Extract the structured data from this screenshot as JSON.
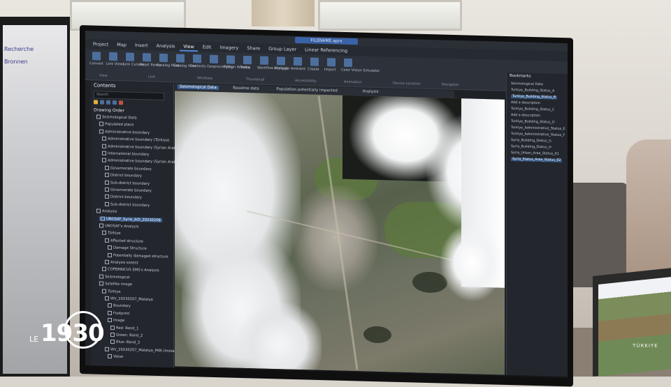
{
  "app": {
    "window_title": "FILENAME.aprx",
    "ribbon_tabs": [
      "Project",
      "Map",
      "Insert",
      "Analysis",
      "View",
      "Edit",
      "Imagery",
      "Share",
      "Group Layer",
      "Linear Referencing"
    ],
    "active_tab": "View",
    "ribbon_buttons": [
      "Convert",
      "Link Views",
      "Link Cursors",
      "Reset Panes",
      "Catalog Pane",
      "Catalog View",
      "Contents",
      "Geoprocessing",
      "Python Window",
      "Tasks",
      "Workflow Manager",
      "Analysis",
      "Ambient",
      "Create",
      "Import",
      "Color Vision Simulator"
    ],
    "ribbon_groups": [
      "View",
      "Link",
      "Windows",
      "Thumbnail",
      "Accessibility",
      "Animation",
      "Device Location",
      "Navigator"
    ]
  },
  "contents": {
    "title": "Contents",
    "search_placeholder": "Search",
    "section": "Drawing Order",
    "items": [
      {
        "label": "Seismological Data",
        "hl": false
      },
      {
        "label": "Populated place",
        "hl": false
      },
      {
        "label": "Administrative boundary",
        "hl": false
      },
      {
        "label": "Administrative boundary (Türkiye)",
        "hl": false
      },
      {
        "label": "Administrative boundary (Syrian Arab Rep)",
        "hl": false
      },
      {
        "label": "International boundary",
        "hl": false
      },
      {
        "label": "Administrative boundary (Syrian Arab R)",
        "hl": false
      },
      {
        "label": "Governorate boundary",
        "hl": false
      },
      {
        "label": "District boundary",
        "hl": false
      },
      {
        "label": "Sub-district boundary",
        "hl": false
      },
      {
        "label": "Governorate boundary",
        "hl": false
      },
      {
        "label": "District boundary",
        "hl": false
      },
      {
        "label": "Sub-district boundary",
        "hl": false
      },
      {
        "label": "Analysis",
        "hl": false
      },
      {
        "label": "UNOSAT_Syria_AOI_20230208",
        "hl": true
      },
      {
        "label": "UNOSAT's Analysis",
        "hl": false
      },
      {
        "label": "Türkiye",
        "hl": false
      },
      {
        "label": "Affected structure",
        "hl": false
      },
      {
        "label": "Damage Structure",
        "hl": false
      },
      {
        "label": "Potentially damaged structure",
        "hl": false
      },
      {
        "label": "Analysis extent",
        "hl": false
      },
      {
        "label": "COPERNICUS EMS's Analysis",
        "hl": false
      },
      {
        "label": "Seismological",
        "hl": false
      },
      {
        "label": "Satellite image",
        "hl": false
      },
      {
        "label": "Türkiye",
        "hl": false
      },
      {
        "label": "WV_20230207_Malatya",
        "hl": false
      },
      {
        "label": "Boundary",
        "hl": false
      },
      {
        "label": "Footprint",
        "hl": false
      },
      {
        "label": "Image",
        "hl": false
      },
      {
        "label": "Red: Band_1",
        "hl": false
      },
      {
        "label": "Green: Band_2",
        "hl": false
      },
      {
        "label": "Blue: Band_3",
        "hl": false
      },
      {
        "label": "WV_20230207_Malatya_PAN (mosaic)",
        "hl": false
      },
      {
        "label": "Value",
        "hl": false
      }
    ]
  },
  "map_tabs": [
    {
      "label": "Seismological Data",
      "active": true
    },
    {
      "label": "Baseline data",
      "active": false
    },
    {
      "label": "Population potentially impacted",
      "active": false
    },
    {
      "label": "Analysis",
      "active": false
    }
  ],
  "bookmarks": {
    "title": "Bookmarks",
    "items": [
      {
        "label": "Seismological Data",
        "sel": false
      },
      {
        "label": "Turkiye_Building_Status_A",
        "sel": false
      },
      {
        "label": "Turkiye_Building_Status_B",
        "sel": true
      },
      {
        "label": "Add a description",
        "sel": false
      },
      {
        "label": "Turkiye_Building_Status_C",
        "sel": false
      },
      {
        "label": "Add a description",
        "sel": false
      },
      {
        "label": "Turkiye_Building_Status_D",
        "sel": false
      },
      {
        "label": "Turkiye_Administrative_Status_E",
        "sel": false
      },
      {
        "label": "Turkiye_Administrative_Status_F",
        "sel": false
      },
      {
        "label": "Syria_Building_Status_G",
        "sel": false
      },
      {
        "label": "Syria_Building_Status_H",
        "sel": false
      },
      {
        "label": "Syria_Urban_Area_Status_01",
        "sel": false
      },
      {
        "label": "Syria_Status_Area_Status_02",
        "sel": true
      }
    ]
  },
  "laptop": {
    "map_label": "TÜRKIYE"
  },
  "logo": {
    "prefix": "LE",
    "number": "1930"
  },
  "colors": {
    "accent": "#3a62a6",
    "selection": "#345684",
    "dark_bg": "#1e2126"
  }
}
